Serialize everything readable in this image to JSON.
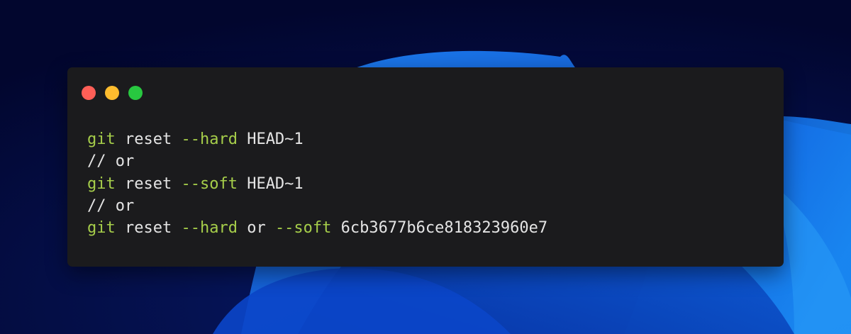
{
  "window": {
    "controls": [
      {
        "name": "close",
        "color": "#ff5f57"
      },
      {
        "name": "minimize",
        "color": "#febc2e"
      },
      {
        "name": "zoom",
        "color": "#28c840"
      }
    ]
  },
  "code": {
    "lines": [
      [
        {
          "text": "git",
          "kind": "keyword"
        },
        {
          "text": " reset ",
          "kind": "text"
        },
        {
          "text": "--hard",
          "kind": "flag"
        },
        {
          "text": " HEAD~1",
          "kind": "text"
        }
      ],
      [
        {
          "text": "// or",
          "kind": "text"
        }
      ],
      [
        {
          "text": "git",
          "kind": "keyword"
        },
        {
          "text": " reset ",
          "kind": "text"
        },
        {
          "text": "--soft",
          "kind": "flag"
        },
        {
          "text": " HEAD~1",
          "kind": "text"
        }
      ],
      [
        {
          "text": "// or",
          "kind": "text"
        }
      ],
      [
        {
          "text": "git",
          "kind": "keyword"
        },
        {
          "text": " reset ",
          "kind": "text"
        },
        {
          "text": "--hard",
          "kind": "flag"
        },
        {
          "text": " or ",
          "kind": "text"
        },
        {
          "text": "--soft",
          "kind": "flag"
        },
        {
          "text": " 6cb3677b6ce818323960e7",
          "kind": "text"
        }
      ]
    ]
  },
  "colors": {
    "background": "#03083a",
    "window": "#1b1b1d",
    "keyword": "#a6ce4a",
    "text": "#e4e4e4"
  }
}
